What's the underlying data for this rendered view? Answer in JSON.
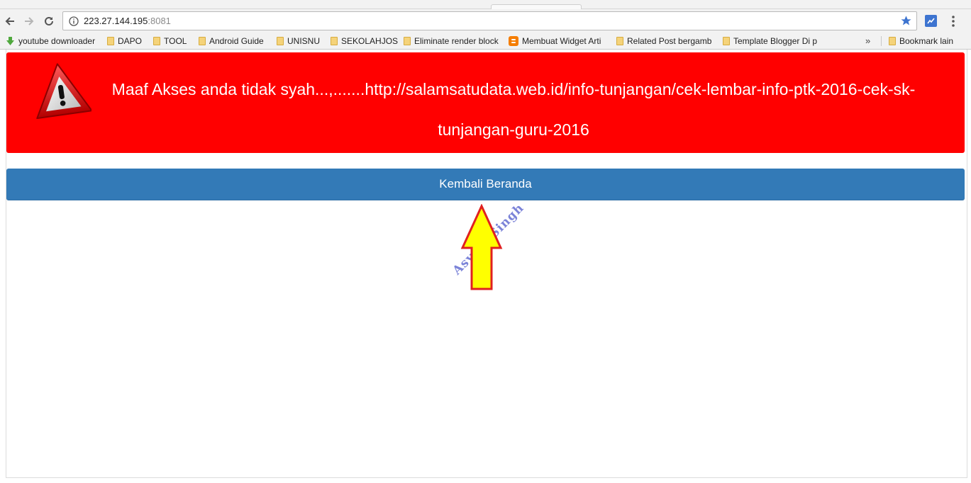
{
  "browser": {
    "url_host": "223.27.144.195",
    "url_port": ":8081",
    "bookmarks": [
      {
        "label": "youtube downloader",
        "icon": "download-arrow-icon"
      },
      {
        "label": "DAPO",
        "icon": "folder-icon"
      },
      {
        "label": "TOOL",
        "icon": "folder-icon"
      },
      {
        "label": "Android Guide",
        "icon": "folder-icon"
      },
      {
        "label": "UNISNU",
        "icon": "folder-icon"
      },
      {
        "label": "SEKOLAHJOS",
        "icon": "folder-icon"
      },
      {
        "label": "Eliminate render block",
        "icon": "folder-icon"
      },
      {
        "label": "Membuat Widget Arti",
        "icon": "blogger-icon"
      },
      {
        "label": "Related Post bergamb",
        "icon": "folder-icon"
      },
      {
        "label": "Template Blogger Di p",
        "icon": "folder-icon"
      }
    ],
    "overflow_label": "»",
    "other_bookmarks": "Bookmark lain"
  },
  "alert": {
    "message": "Maaf Akses anda tidak syah...,.......http://salamsatudata.web.id/info-tunjangan/cek-lembar-info-ptk-2016-cek-sk-tunjangan-guru-2016",
    "icon": "warning-triangle-icon",
    "color": "#ff0000"
  },
  "home_button": {
    "label": "Kembali Beranda",
    "color": "#337ab7"
  },
  "annotation": {
    "watermark": "Asyrof Singh",
    "arrow_color": "#ffff00",
    "arrow_outline": "#e02020"
  }
}
